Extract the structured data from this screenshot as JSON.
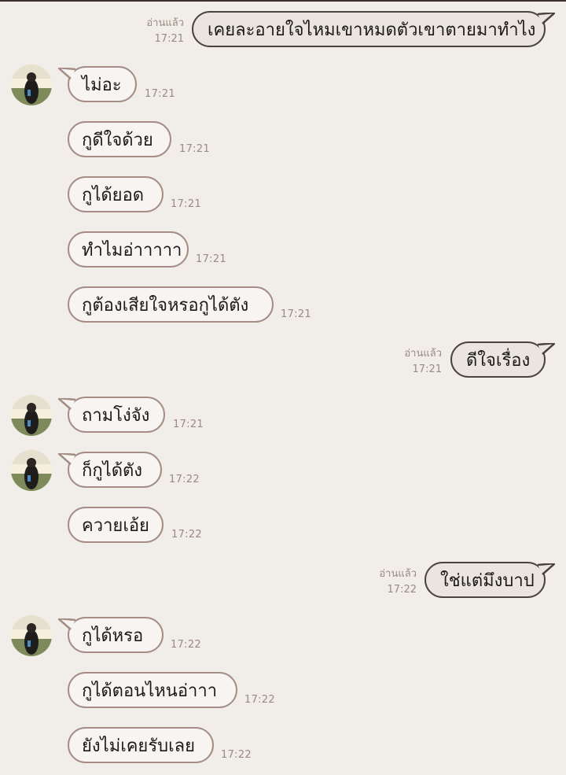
{
  "conversation": {
    "read_label": "อ่านแล้ว",
    "messages": [
      {
        "dir": "out",
        "text": "เคยละอายใจไหมเขาหมดตัวเขาตายมาทำไง",
        "time": "17:21",
        "read": "อ่านแล้ว"
      },
      {
        "dir": "in",
        "text": "ไม่อะ",
        "time": "17:21",
        "avatar": true
      },
      {
        "dir": "in",
        "text": "กูดีใจด้วย",
        "time": "17:21"
      },
      {
        "dir": "in",
        "text": "กูได้ยอด",
        "time": "17:21"
      },
      {
        "dir": "in",
        "text": "ทำไมอ่าาาาา",
        "time": "17:21"
      },
      {
        "dir": "in",
        "text": "กูต้องเสียใจหรอกูได้ตัง",
        "time": "17:21"
      },
      {
        "dir": "out",
        "text": "ดีใจเรื่อง",
        "time": "17:21",
        "read": "อ่านแล้ว"
      },
      {
        "dir": "in",
        "text": "ถามโง่จัง",
        "time": "17:21",
        "avatar": true
      },
      {
        "dir": "in",
        "text": "ก็กูได้ตัง",
        "time": "17:22",
        "avatar": true
      },
      {
        "dir": "in",
        "text": "ควายเอ้ย",
        "time": "17:22"
      },
      {
        "dir": "out",
        "text": "ใช่แต่มึงบาป",
        "time": "17:22",
        "read": "อ่านแล้ว"
      },
      {
        "dir": "in",
        "text": "กูได้หรอ",
        "time": "17:22",
        "avatar": true
      },
      {
        "dir": "in",
        "text": "กูได้ตอนไหนอ่าาา",
        "time": "17:22"
      },
      {
        "dir": "in",
        "text": "ยังไม่เคยรับเลย",
        "time": "17:22"
      }
    ]
  },
  "colors": {
    "background": "#f1ede8",
    "incoming_border": "#a38d84",
    "outgoing_border": "#4a4342",
    "timestamp": "#9b8a80"
  }
}
